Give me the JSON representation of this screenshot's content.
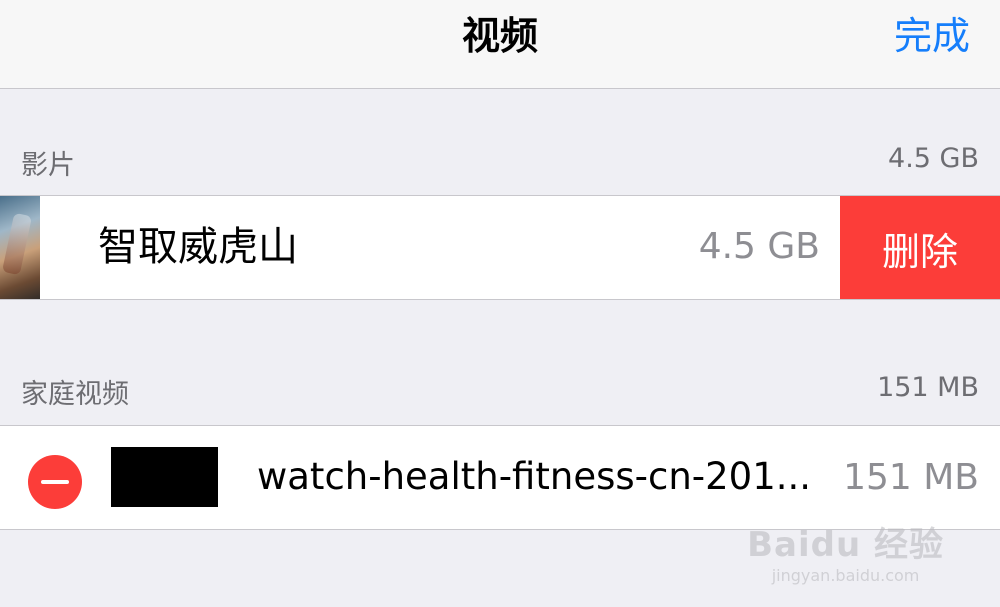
{
  "nav": {
    "title": "视频",
    "done_label": "完成"
  },
  "sections": [
    {
      "label": "影片",
      "size": "4.5 GB",
      "item": {
        "title": "智取威虎山",
        "size": "4.5 GB",
        "delete_label": "删除"
      }
    },
    {
      "label": "家庭视频",
      "size": "151 MB",
      "item": {
        "title": "watch-health-fitness-cn-201...",
        "size": "151 MB"
      }
    }
  ],
  "watermark": {
    "main": "Baidu 经验",
    "sub": "jingyan.baidu.com"
  },
  "colors": {
    "accent": "#157efb",
    "destructive": "#fc3d39",
    "background": "#efeff4"
  },
  "icons": {
    "remove": "minus-circle-icon"
  }
}
